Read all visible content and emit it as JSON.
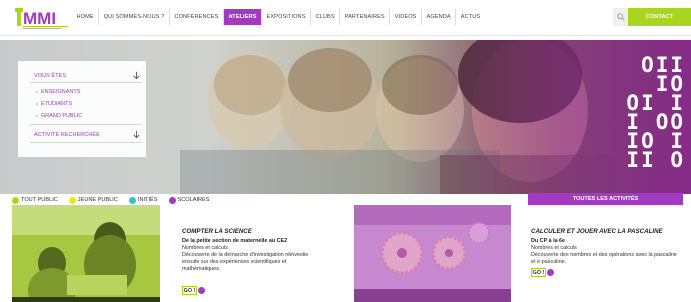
{
  "brand": {
    "logo_text": "IT MMI",
    "logo_colors": [
      "#a8d620",
      "#a23bc1"
    ]
  },
  "nav": {
    "items": [
      {
        "label": "HOME",
        "active": false
      },
      {
        "label": "QUI SOMMES-NOUS ?",
        "active": false
      },
      {
        "label": "CONFÉRENCES",
        "active": false
      },
      {
        "label": "ATELIERS",
        "active": true
      },
      {
        "label": "EXPOSITIONS",
        "active": false
      },
      {
        "label": "CLUBS",
        "active": false
      },
      {
        "label": "PARTENAIRES",
        "active": false
      },
      {
        "label": "VIDÉOS",
        "active": false
      },
      {
        "label": "AGENDA",
        "active": false
      },
      {
        "label": "ACTUS",
        "active": false
      }
    ],
    "search_icon": "search-icon",
    "contact_label": "CONTACT"
  },
  "hero": {
    "binary_lines": [
      "OII",
      "IO",
      "OI I",
      "I OO",
      "IO I",
      "II O",
      "OI I"
    ],
    "filter": {
      "audience_label": "VOUS ÊTES",
      "audience_options": [
        "ENSEIGNANTS",
        "ÉTUDIANTS",
        "GRAND PUBLIC"
      ],
      "activity_label": "ACTIVITÉ RECHERCHÉE"
    }
  },
  "legend": {
    "items": [
      {
        "label": "TOUT PUBLIC",
        "color": "#a8d620"
      },
      {
        "label": "JEUNE PUBLIC",
        "color": "#f2e21b"
      },
      {
        "label": "INITIÉS",
        "color": "#2bc4d8"
      },
      {
        "label": "SCOLAIRES",
        "color": "#a23bc1"
      }
    ],
    "all_activities_label": "TOUTES LES ACTIVITÉS"
  },
  "cards": [
    {
      "title": "COMPTER LA SCIENCE",
      "level": "De la petite section de maternelle au CE2",
      "topic": "Nombres et calculs",
      "description": "Découverte de la démarche d'investigation réinvestie ensuite sur des expériences scientifiques et mathématiques.",
      "button": "GO !"
    },
    {
      "title": "CALCULER ET JOUER AVEC LA PASCALINE",
      "level": "Du CP à la 6e",
      "topic": "Nombres et calculs",
      "description": "Découverte des nombres et des opérations avec la pascaline et e-pascaline.",
      "button": "GO !"
    }
  ],
  "colors": {
    "accent_purple": "#a23bc1",
    "accent_green": "#a8d620"
  }
}
